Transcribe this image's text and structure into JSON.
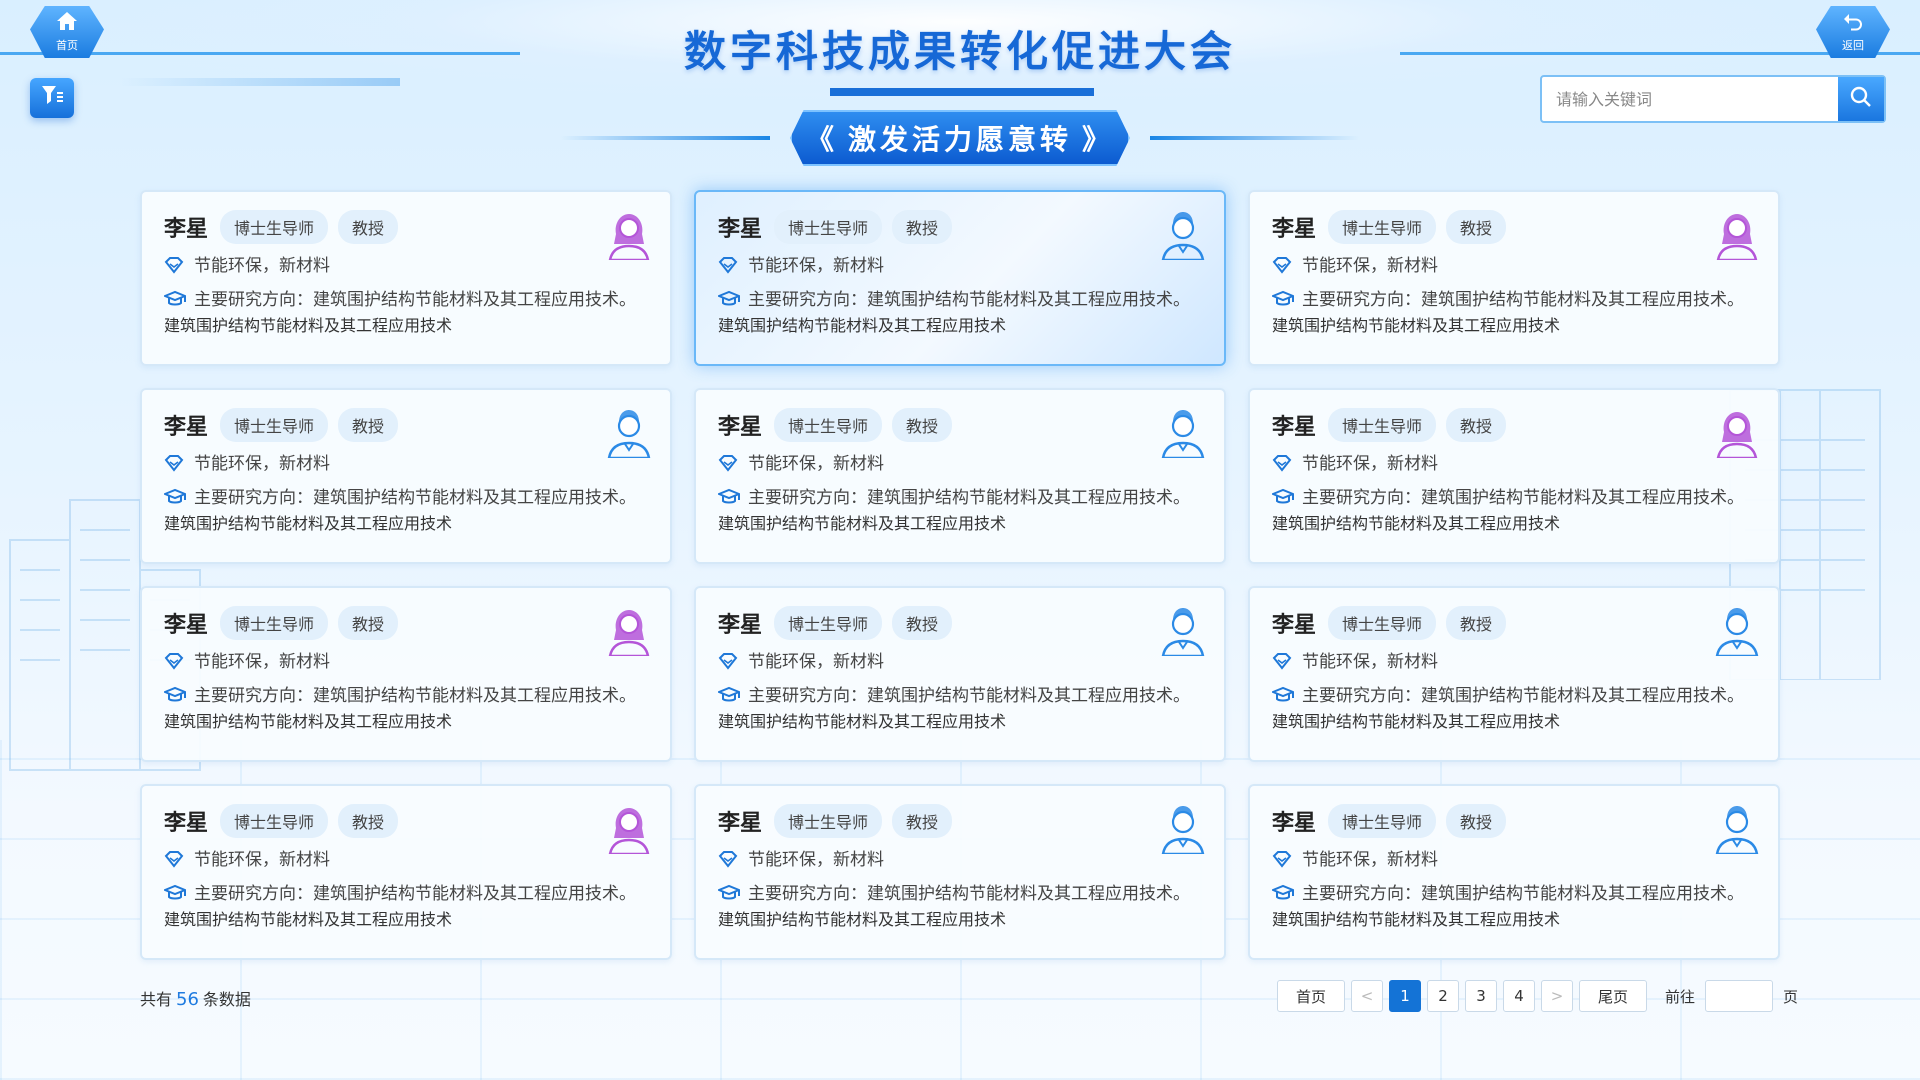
{
  "header": {
    "title": "数字科技成果转化促进大会",
    "subtitle": "激发活力愿意转",
    "home_label": "首页",
    "back_label": "返回"
  },
  "search": {
    "placeholder": "请输入关键词"
  },
  "cards": [
    {
      "name": "李星",
      "tag1": "博士生导师",
      "tag2": "教授",
      "field": "节能环保，新材料",
      "research": "主要研究方向：建筑围护结构节能材料及其工程应用技术。",
      "research2": "建筑围护结构节能材料及其工程应用技术",
      "avatar": "female"
    },
    {
      "name": "李星",
      "tag1": "博士生导师",
      "tag2": "教授",
      "field": "节能环保，新材料",
      "research": "主要研究方向：建筑围护结构节能材料及其工程应用技术。",
      "research2": "建筑围护结构节能材料及其工程应用技术",
      "avatar": "male"
    },
    {
      "name": "李星",
      "tag1": "博士生导师",
      "tag2": "教授",
      "field": "节能环保，新材料",
      "research": "主要研究方向：建筑围护结构节能材料及其工程应用技术。",
      "research2": "建筑围护结构节能材料及其工程应用技术",
      "avatar": "female"
    },
    {
      "name": "李星",
      "tag1": "博士生导师",
      "tag2": "教授",
      "field": "节能环保，新材料",
      "research": "主要研究方向：建筑围护结构节能材料及其工程应用技术。",
      "research2": "建筑围护结构节能材料及其工程应用技术",
      "avatar": "male"
    },
    {
      "name": "李星",
      "tag1": "博士生导师",
      "tag2": "教授",
      "field": "节能环保，新材料",
      "research": "主要研究方向：建筑围护结构节能材料及其工程应用技术。",
      "research2": "建筑围护结构节能材料及其工程应用技术",
      "avatar": "male"
    },
    {
      "name": "李星",
      "tag1": "博士生导师",
      "tag2": "教授",
      "field": "节能环保，新材料",
      "research": "主要研究方向：建筑围护结构节能材料及其工程应用技术。",
      "research2": "建筑围护结构节能材料及其工程应用技术",
      "avatar": "female"
    },
    {
      "name": "李星",
      "tag1": "博士生导师",
      "tag2": "教授",
      "field": "节能环保，新材料",
      "research": "主要研究方向：建筑围护结构节能材料及其工程应用技术。",
      "research2": "建筑围护结构节能材料及其工程应用技术",
      "avatar": "female"
    },
    {
      "name": "李星",
      "tag1": "博士生导师",
      "tag2": "教授",
      "field": "节能环保，新材料",
      "research": "主要研究方向：建筑围护结构节能材料及其工程应用技术。",
      "research2": "建筑围护结构节能材料及其工程应用技术",
      "avatar": "male"
    },
    {
      "name": "李星",
      "tag1": "博士生导师",
      "tag2": "教授",
      "field": "节能环保，新材料",
      "research": "主要研究方向：建筑围护结构节能材料及其工程应用技术。",
      "research2": "建筑围护结构节能材料及其工程应用技术",
      "avatar": "male"
    },
    {
      "name": "李星",
      "tag1": "博士生导师",
      "tag2": "教授",
      "field": "节能环保，新材料",
      "research": "主要研究方向：建筑围护结构节能材料及其工程应用技术。",
      "research2": "建筑围护结构节能材料及其工程应用技术",
      "avatar": "female"
    },
    {
      "name": "李星",
      "tag1": "博士生导师",
      "tag2": "教授",
      "field": "节能环保，新材料",
      "research": "主要研究方向：建筑围护结构节能材料及其工程应用技术。",
      "research2": "建筑围护结构节能材料及其工程应用技术",
      "avatar": "male"
    },
    {
      "name": "李星",
      "tag1": "博士生导师",
      "tag2": "教授",
      "field": "节能环保，新材料",
      "research": "主要研究方向：建筑围护结构节能材料及其工程应用技术。",
      "research2": "建筑围护结构节能材料及其工程应用技术",
      "avatar": "male"
    }
  ],
  "active_card": 1,
  "footer": {
    "total_prefix": "共有",
    "total_count": "56",
    "total_suffix": "条数据",
    "first_label": "首页",
    "last_label": "尾页",
    "pages": [
      "1",
      "2",
      "3",
      "4"
    ],
    "current_page": "1",
    "goto_label": "前往",
    "page_unit": "页",
    "prev_glyph": "<",
    "next_glyph": ">"
  },
  "colors": {
    "accent": "#1473d6",
    "title": "#1668d6",
    "female_avatar": "#b455d8",
    "male_avatar": "#2b8ae6"
  },
  "icons": {
    "home": "home-icon",
    "back": "return-icon",
    "filter": "filter-icon",
    "search": "search-icon",
    "field": "diamond-icon",
    "research": "graduation-cap-icon"
  }
}
